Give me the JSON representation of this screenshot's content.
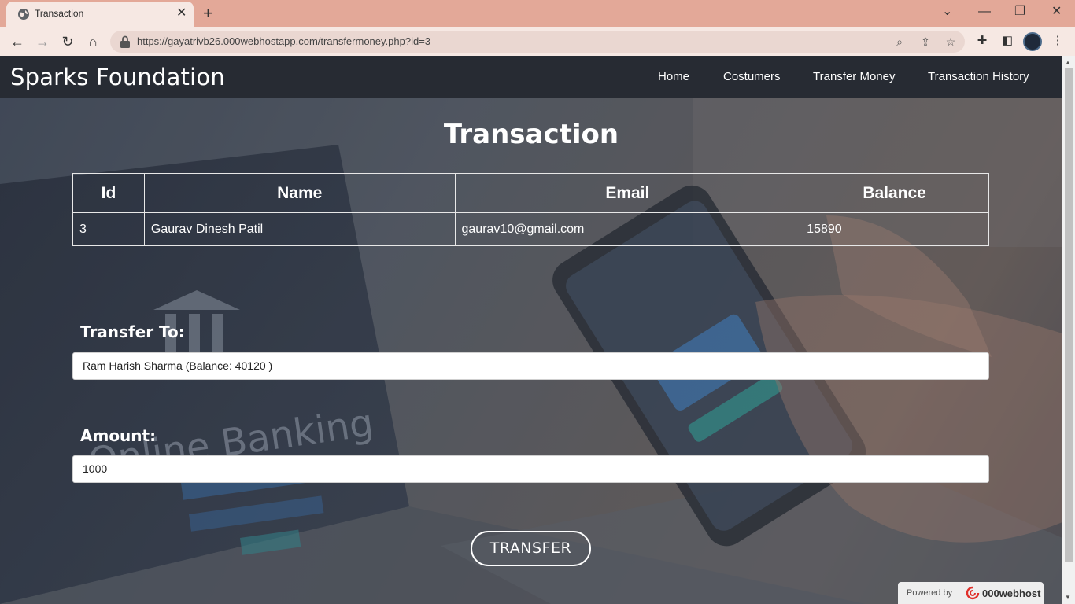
{
  "browser": {
    "tab_title": "Transaction",
    "url": "https://gayatrivb26.000webhostapp.com/transfermoney.php?id=3",
    "icons": [
      "globe-icon",
      "close-icon",
      "plus-icon",
      "chevron-down-icon",
      "minimize-icon",
      "restore-icon",
      "close-window-icon",
      "back-icon",
      "forward-icon",
      "reload-icon",
      "home-icon",
      "lock-icon",
      "zoom-icon",
      "share-icon",
      "star-icon",
      "puzzle-icon",
      "sidepanel-icon",
      "avatar",
      "kebab-menu-icon"
    ]
  },
  "navbar": {
    "brand": "Sparks Foundation",
    "links": [
      "Home",
      "Costumers",
      "Transfer Money",
      "Transaction History"
    ]
  },
  "main": {
    "title": "Transaction",
    "table": {
      "headers": [
        "Id",
        "Name",
        "Email",
        "Balance"
      ],
      "row": [
        "3",
        "Gaurav Dinesh Patil",
        "gaurav10@gmail.com",
        "15890"
      ]
    },
    "transfer_to_label": "Transfer To:",
    "transfer_to_value": "Ram Harish Sharma (Balance: 40120 )",
    "amount_label": "Amount:",
    "amount_value": "1000",
    "transfer_button": "TRANSFER"
  },
  "footer": {
    "powered_by": "Powered by",
    "host_brand": "000webhost"
  },
  "colors": {
    "navbar_bg": "#272b33",
    "tabbar_bg": "#e3a898",
    "text_white": "#ffffff"
  }
}
